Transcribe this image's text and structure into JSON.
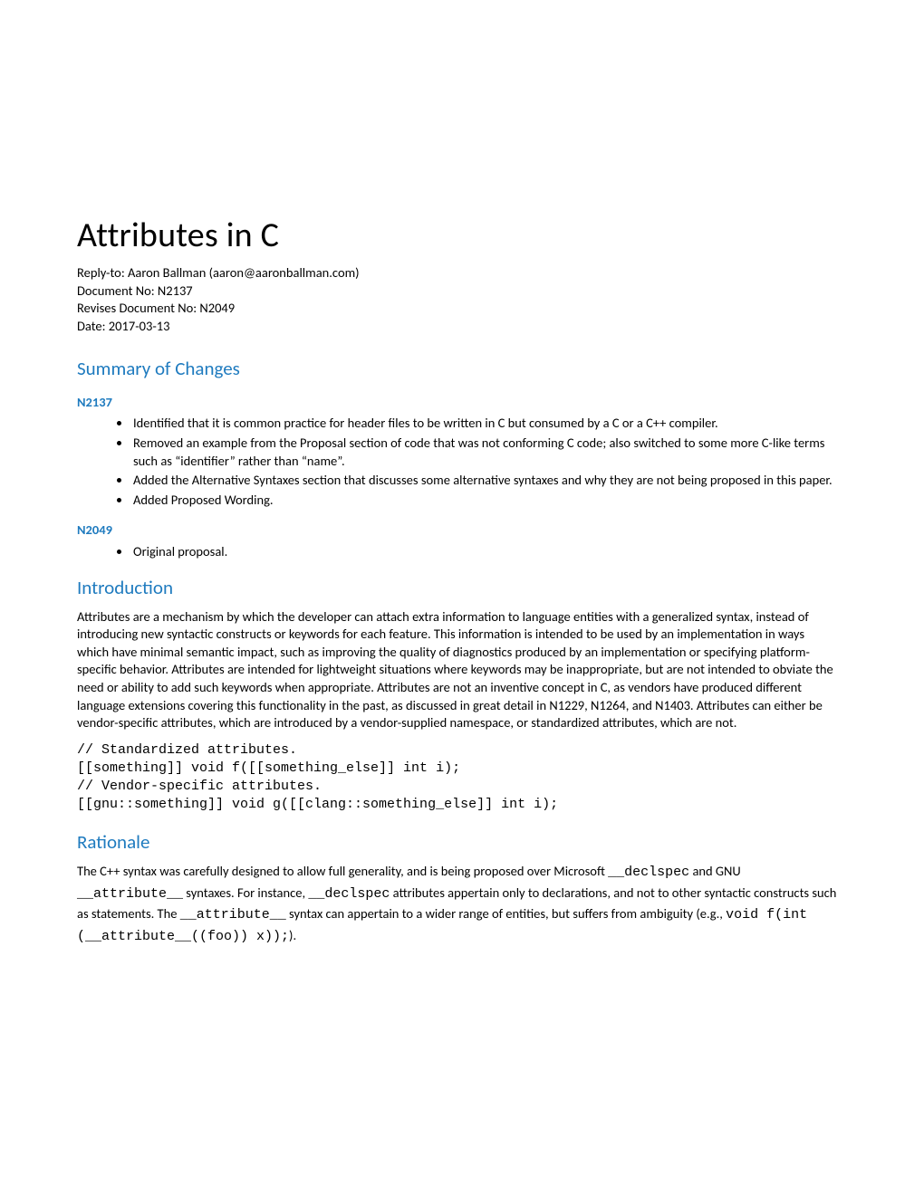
{
  "title": "Attributes in C",
  "meta": {
    "reply_to": "Reply-to: Aaron Ballman (aaron@aaronballman.com)",
    "doc_no": "Document No: N2137",
    "revises": "Revises Document No: N2049",
    "date": "Date: 2017-03-13"
  },
  "summary_heading": "Summary of Changes",
  "changes": {
    "n2137_label": "N2137",
    "n2137_items": [
      "Identified that it is common practice for header files to be written in C but consumed by a C or a C++ compiler.",
      "Removed an example from the Proposal section of code that was not conforming C code; also switched to some more C-like terms such as “identifier” rather than “name”.",
      "Added the Alternative Syntaxes section that discusses some alternative syntaxes and why they are not being proposed in this paper.",
      "Added Proposed Wording."
    ],
    "n2049_label": "N2049",
    "n2049_items": [
      "Original proposal."
    ]
  },
  "intro_heading": "Introduction",
  "intro_para": "Attributes are a mechanism by which the developer can attach extra information to language entities with a generalized syntax, instead of introducing new syntactic constructs or keywords for each feature. This information is intended to be used by an implementation in ways which have minimal semantic impact, such as improving the quality of diagnostics produced by an implementation or specifying platform-specific behavior. Attributes are intended for lightweight situations where keywords may be inappropriate, but are not intended to obviate the need or ability to add such keywords when appropriate. Attributes are not an inventive concept in C, as vendors have produced different language extensions covering this functionality in the past, as discussed in great detail in N1229, N1264, and N1403. Attributes can either be vendor-specific attributes, which are introduced by a vendor-supplied namespace, or standardized attributes, which are not.",
  "code_block": "// Standardized attributes.\n[[something]] void f([[something_else]] int i);\n// Vendor-specific attributes.\n[[gnu::something]] void g([[clang::something_else]] int i);",
  "rationale_heading": "Rationale",
  "rationale": {
    "t1": "The C++ syntax was carefully designed to allow full generality, and is being proposed over Microsoft ",
    "m1": "__declspec",
    "t2": " and GNU ",
    "m2": "__attribute__",
    "t3": " syntaxes. For instance, ",
    "m3": "__declspec",
    "t4": " attributes appertain only to declarations, and not to other syntactic constructs such as statements. The ",
    "m4": "__attribute__",
    "t5": " syntax can appertain to a wider range of entities, but suffers from ambiguity (e.g., ",
    "m5": "void f(int (__attribute__((foo)) x));",
    "t6": ")."
  }
}
